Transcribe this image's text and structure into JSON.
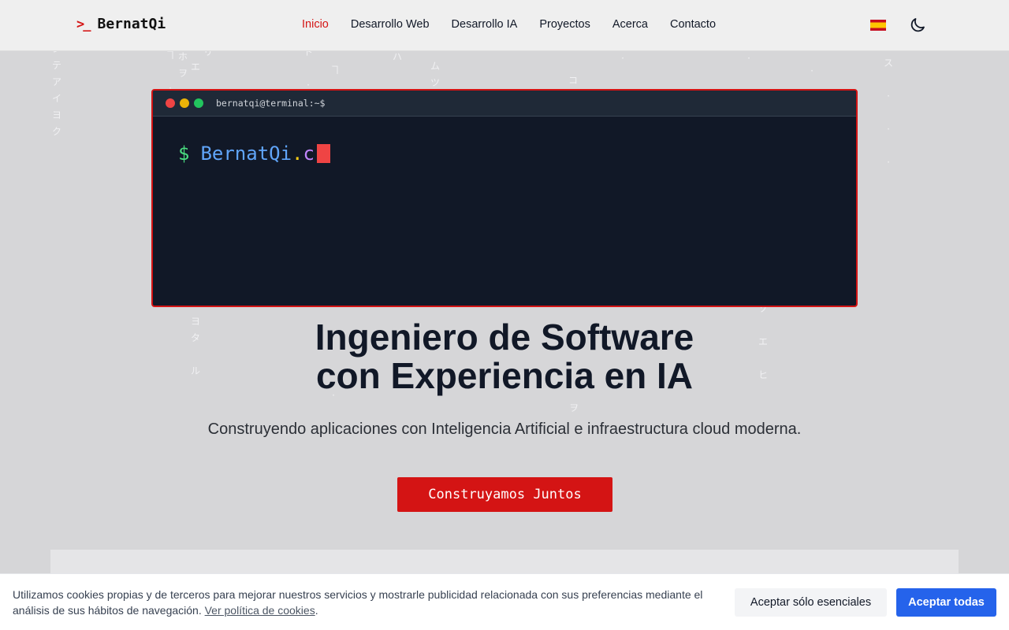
{
  "nav": {
    "logo_icon": ">_",
    "logo_text": "BernatQi",
    "links": [
      "Inicio",
      "Desarrollo Web",
      "Desarrollo IA",
      "Proyectos",
      "Acerca",
      "Contacto"
    ],
    "language_flag": "flag-spain-icon",
    "theme_toggle": "moon-icon"
  },
  "terminal": {
    "title": "bernatqi@terminal:~$",
    "prompt": "$",
    "typed_part1": "BernatQi",
    "typed_dot": ".",
    "typed_part2": "c"
  },
  "hero": {
    "title_line1": "Ingeniero de Software",
    "title_line2": "con Experiencia en IA",
    "subtitle": "Construyendo aplicaciones con Inteligencia Artificial e infraestructura cloud moderna.",
    "cta": "Construyamos Juntos"
  },
  "cookie": {
    "text": "Utilizamos cookies propias y de terceros para mejorar nuestros servicios y mostrarle publicidad relacionada con sus preferencias mediante el análisis de sus hábitos de navegación.",
    "link": "Ver política de cookies",
    "after_link": ".",
    "button_essential": "Aceptar sólo esenciales",
    "button_all": "Aceptar todas"
  },
  "colors": {
    "accent": "#d41414",
    "terminal_bg": "#111827",
    "page_bg": "#d6d6d8",
    "primary_button": "#2563eb"
  }
}
